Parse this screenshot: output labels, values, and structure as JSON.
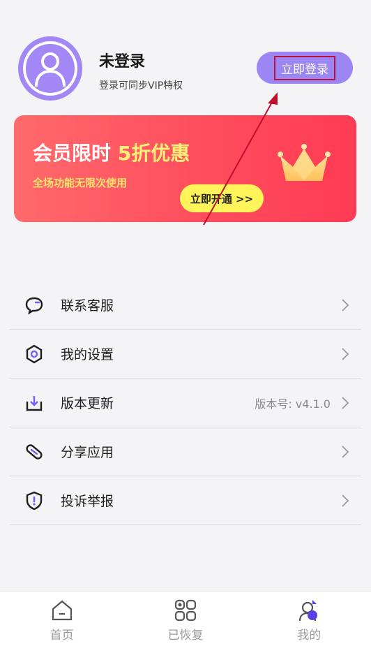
{
  "profile": {
    "name": "未登录",
    "subtitle": "登录可同步VIP特权",
    "login_button": "立即登录"
  },
  "banner": {
    "title_prefix": "会员限时",
    "title_highlight": "5折优惠",
    "subtitle": "全场功能无限次使用",
    "cta": "立即开通 >>"
  },
  "menu": {
    "items": [
      {
        "label": "联系客服",
        "icon": "chat-bubble-icon"
      },
      {
        "label": "我的设置",
        "icon": "hexagon-settings-icon"
      },
      {
        "label": "版本更新",
        "icon": "download-icon",
        "extra": "版本号: v4.1.0"
      },
      {
        "label": "分享应用",
        "icon": "link-share-icon"
      },
      {
        "label": "投诉举报",
        "icon": "shield-alert-icon"
      }
    ]
  },
  "bottom_nav": {
    "items": [
      {
        "label": "首页",
        "icon": "home-icon"
      },
      {
        "label": "已恢复",
        "icon": "grid-icon"
      },
      {
        "label": "我的",
        "icon": "profile-icon",
        "active": true
      }
    ]
  },
  "colors": {
    "accent": "#9c86f3",
    "banner_start": "#ff6a6c",
    "banner_end": "#ff3b55",
    "annotation": "#c0102c"
  }
}
